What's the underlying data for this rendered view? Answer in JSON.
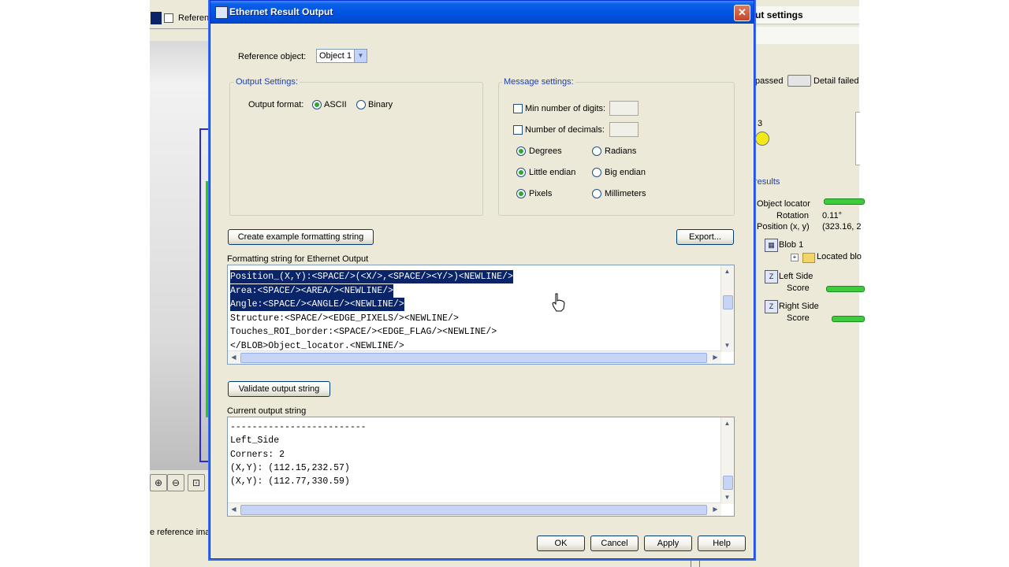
{
  "background": {
    "tab_label": "Referen",
    "status_text": "e reference ima",
    "zoom_buttons": [
      "zoom-in-icon",
      "zoom-out-icon",
      "zoom-fit-icon"
    ],
    "right_panel": {
      "title": "ut settings",
      "legend_passed": "passed",
      "legend_detail_failed": "Detail failed",
      "count": "3",
      "results_label": "results",
      "object_locator": "Object locator",
      "rotation_label": "Rotation",
      "rotation_value": "0.11°",
      "position_label": "Position (x, y)",
      "position_value": "(323.16, 2",
      "blob": "Blob 1",
      "located_blob": "Located blo",
      "left_side": "Left Side",
      "left_side_score": "Score",
      "right_side": "Right Side",
      "right_side_score": "Score"
    }
  },
  "dialog": {
    "title": "Ethernet Result Output",
    "reference_object_label": "Reference object:",
    "reference_object_value": "Object 1",
    "output_settings": {
      "title": "Output Settings:",
      "format_label": "Output format:",
      "ascii": "ASCII",
      "binary": "Binary",
      "selected": "ASCII"
    },
    "message_settings": {
      "title": "Message settings:",
      "min_digits": "Min number of digits:",
      "num_decimals": "Number of decimals:",
      "degrees": "Degrees",
      "radians": "Radians",
      "little_endian": "Little endian",
      "big_endian": "Big endian",
      "pixels": "Pixels",
      "millimeters": "Millimeters",
      "selected_angle": "Degrees",
      "selected_endian": "Little endian",
      "selected_unit": "Pixels"
    },
    "create_example_button": "Create example formatting string",
    "export_button": "Export...",
    "formatting_label": "Formatting string for Ethernet Output",
    "formatting_lines": [
      "Position_(X,Y):<SPACE/>(<X/>,<SPACE/><Y/>)<NEWLINE/>",
      "Area:<SPACE/><AREA/><NEWLINE/>",
      "Angle:<SPACE/><ANGLE/><NEWLINE/>",
      "Structure:<SPACE/><EDGE_PIXELS/><NEWLINE/>",
      "Touches_ROI_border:<SPACE/><EDGE_FLAG/><NEWLINE/>",
      "</BLOB>Object_locator.<NEWLINE/>"
    ],
    "validate_button": "Validate output string",
    "current_output_label": "Current output string",
    "output_lines": [
      "-------------------------",
      "Left_Side",
      "Corners: 2",
      "(X,Y): (112.15,232.57)",
      "(X,Y): (112.77,330.59)"
    ],
    "ok_button": "OK",
    "cancel_button": "Cancel",
    "apply_button": "Apply",
    "help_button": "Help"
  }
}
